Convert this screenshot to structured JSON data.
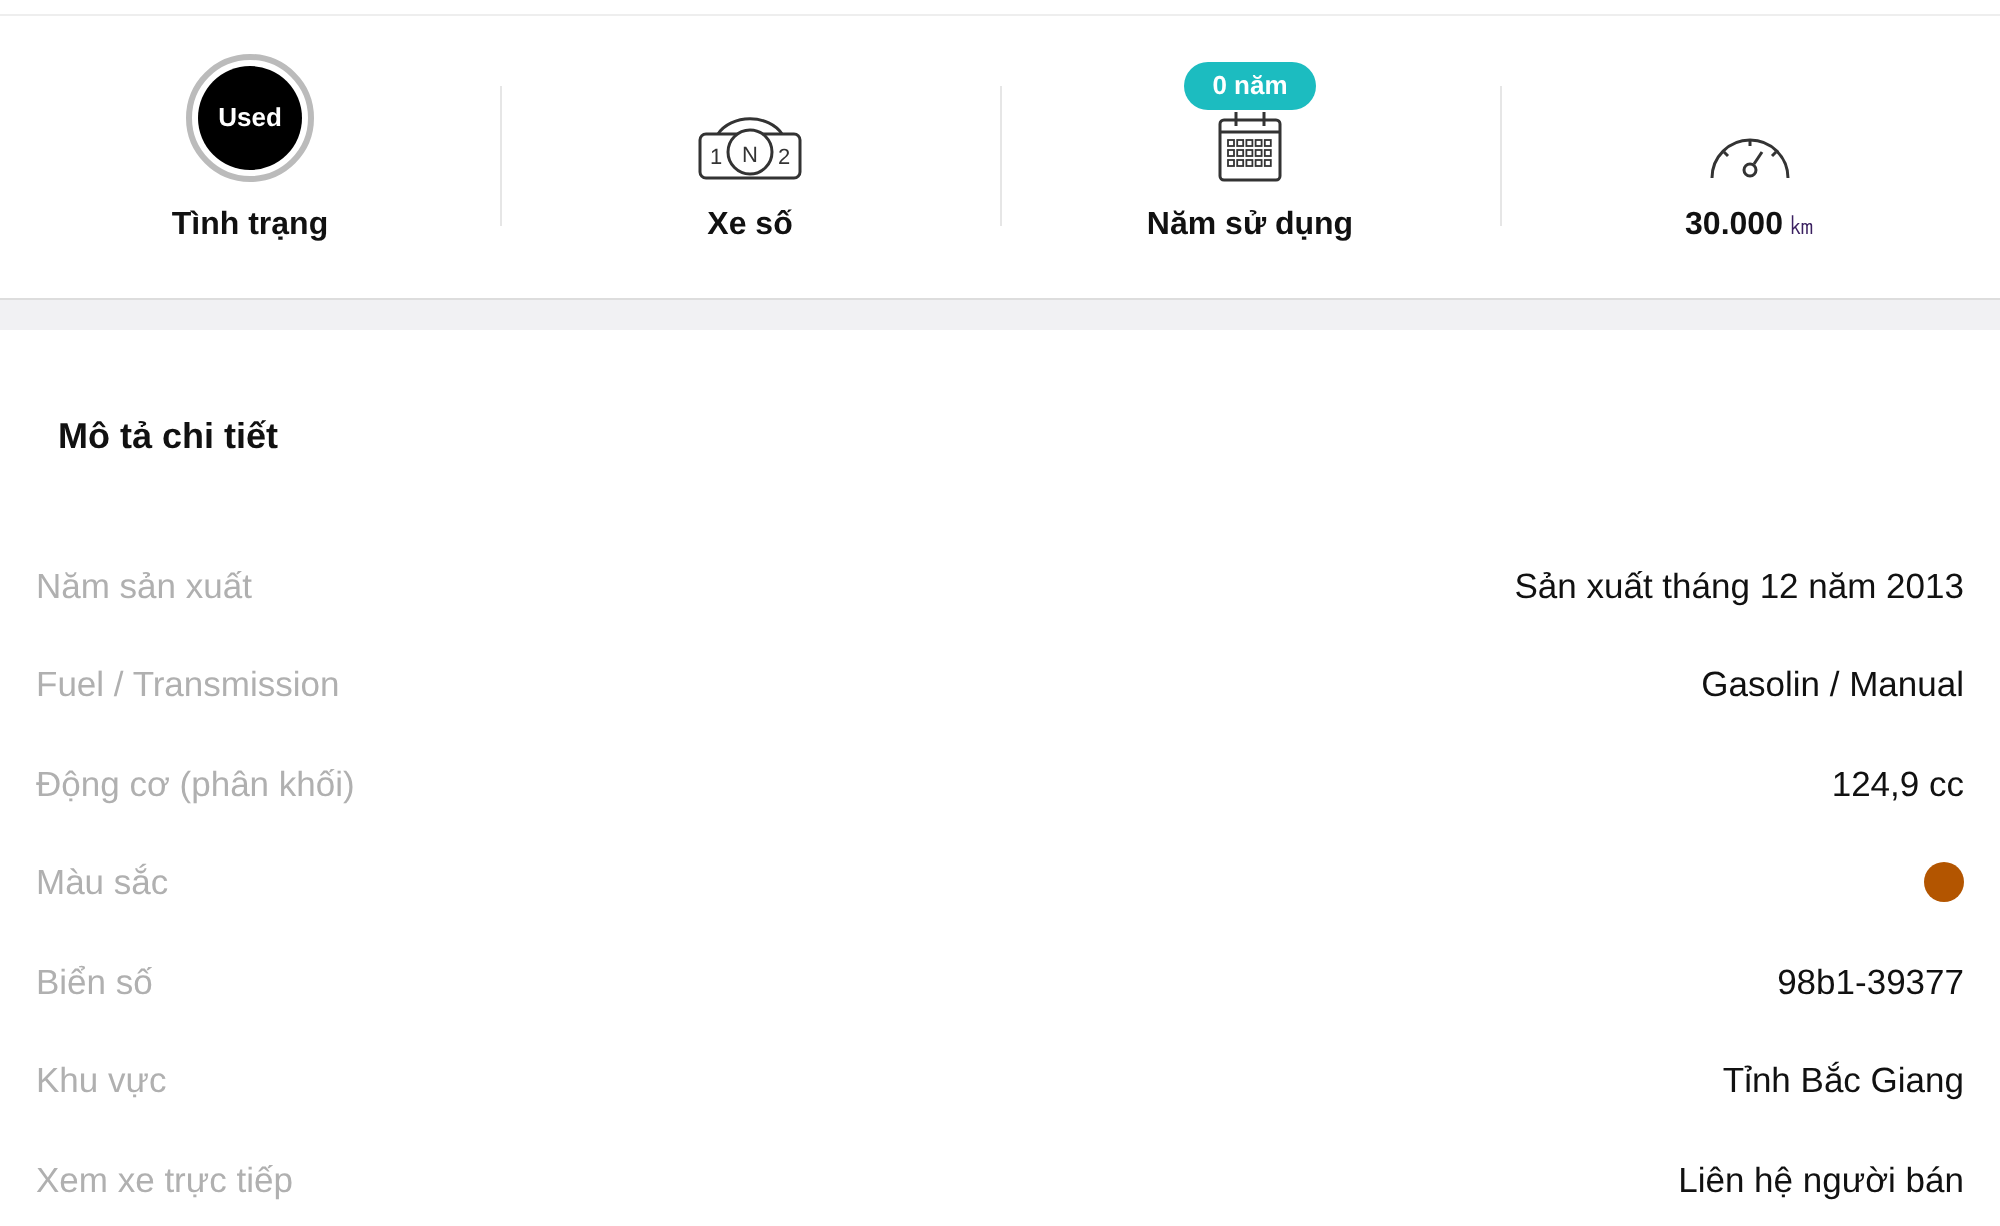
{
  "overview": [
    {
      "kind": "status",
      "icon_text": "Used",
      "label": "Tình trạng"
    },
    {
      "kind": "gearbox",
      "icon_text": [
        "1",
        "N",
        "2"
      ],
      "label": "Xe số"
    },
    {
      "kind": "calendar",
      "badge": "0 năm",
      "label": "Năm sử dụng"
    },
    {
      "kind": "odometer",
      "label": "30.000",
      "unit": "㎞"
    }
  ],
  "details": {
    "title": "Mô tả chi tiết",
    "rows": [
      {
        "kind": "text",
        "label": "Năm sản xuất",
        "value": "Sản xuất tháng 12 năm 2013"
      },
      {
        "kind": "text",
        "label": "Fuel / Transmission",
        "value": "Gasolin / Manual"
      },
      {
        "kind": "text",
        "label": "Động cơ (phân khối)",
        "value": "124,9 cc"
      },
      {
        "kind": "color",
        "label": "Màu sắc",
        "color": "#b35500"
      },
      {
        "kind": "text",
        "label": "Biển số",
        "value": "98b1-39377"
      },
      {
        "kind": "text",
        "label": "Khu vực",
        "value": "Tỉnh Bắc Giang"
      },
      {
        "kind": "text",
        "label": "Xem xe trực tiếp",
        "value": "Liên hệ người bán"
      }
    ]
  }
}
